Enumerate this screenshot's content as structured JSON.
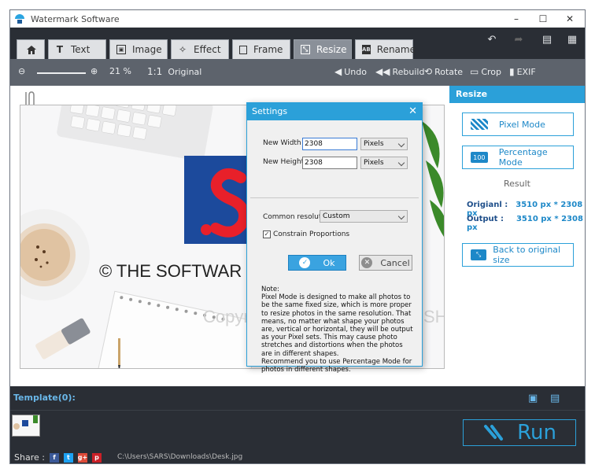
{
  "window": {
    "title": "Watermark Software",
    "controls": [
      "–",
      "☐",
      "✕"
    ]
  },
  "tabs": [
    {
      "label": "",
      "icon": "home-icon"
    },
    {
      "label": "Text",
      "icon": "text-icon"
    },
    {
      "label": "Image",
      "icon": "image-icon"
    },
    {
      "label": "Effect",
      "icon": "effect-icon"
    },
    {
      "label": "Frame",
      "icon": "frame-icon"
    },
    {
      "label": "Resize",
      "icon": "resize-icon",
      "active": true
    },
    {
      "label": "Rename",
      "icon": "rename-icon"
    }
  ],
  "toolbar": {
    "zoom_value": "21 %",
    "original_label": "Original",
    "original_icon_label": "1:1",
    "undo_label": "Undo",
    "rebuild_label": "Rebuild",
    "rotate_label": "Rotate",
    "crop_label": "Crop",
    "exif_label": "EXIF"
  },
  "photo": {
    "copyright_text": "© THE SOFTWAR",
    "watermark_text": "Copyright THE SOFTWARE.SHOP"
  },
  "right_panel": {
    "header": "Resize",
    "pixel_mode_label": "Pixel Mode",
    "percentage_mode_label": "Percentage Mode",
    "percentage_icon_text": "100",
    "result_label": "Result",
    "original_key": "Origianl :",
    "original_value": "3510 px * 2308 px",
    "output_key": "Output :",
    "output_value": "3510 px * 2308 px",
    "back_label": "Back to original size"
  },
  "dialog": {
    "title": "Settings",
    "close": "✕",
    "new_width_label": "New Width :",
    "new_width_value": "2308",
    "width_unit": "Pixels",
    "new_height_label": "New Height :",
    "new_height_value": "2308",
    "height_unit": "Pixels",
    "common_resolution_label": "Common resolution :",
    "common_resolution_value": "Custom",
    "constrain_label": "Constrain Proportions",
    "constrain_checked": "✓",
    "ok_label": "Ok",
    "cancel_label": "Cancel",
    "note": "Note:\nPixel Mode is designed to make all photos to be the same fixed size, which is more proper to resize photos in the same resolution. That means, no matter what shape your photos are, vertical or horizontal, they will be output as your Pixel sets. This may cause photo stretches and distortions when the photos are in different shapes.\nRecommend you to use Percentage Mode for photos in different shapes."
  },
  "bottom": {
    "template_label": "Template(0):",
    "run_label": "Run",
    "share_label": "Share :",
    "file_path": "C:\\Users\\SARS\\Downloads\\Desk.jpg"
  },
  "colors": {
    "accent": "#2ba0d9",
    "dark": "#2a2e35",
    "toolbar": "#5d636c"
  }
}
